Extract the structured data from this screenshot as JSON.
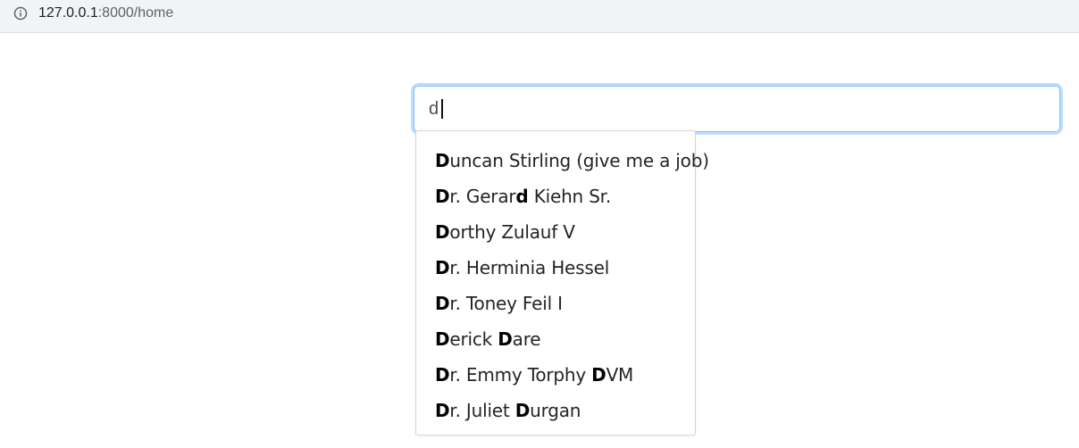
{
  "browser": {
    "url_host": "127.0.0.1",
    "url_path": ":8000/home",
    "info_icon": "info-circle-icon"
  },
  "search": {
    "value": "d"
  },
  "suggestions": [
    {
      "segments": [
        {
          "t": "D",
          "b": true
        },
        {
          "t": "uncan Stirling (give me a job)",
          "b": false
        }
      ]
    },
    {
      "segments": [
        {
          "t": "D",
          "b": true
        },
        {
          "t": "r. Gerar",
          "b": false
        },
        {
          "t": "d",
          "b": true
        },
        {
          "t": " Kiehn Sr.",
          "b": false
        }
      ]
    },
    {
      "segments": [
        {
          "t": "D",
          "b": true
        },
        {
          "t": "orthy Zulauf V",
          "b": false
        }
      ]
    },
    {
      "segments": [
        {
          "t": "D",
          "b": true
        },
        {
          "t": "r. Herminia Hessel",
          "b": false
        }
      ]
    },
    {
      "segments": [
        {
          "t": "D",
          "b": true
        },
        {
          "t": "r. Toney Feil I",
          "b": false
        }
      ]
    },
    {
      "segments": [
        {
          "t": "D",
          "b": true
        },
        {
          "t": "erick ",
          "b": false
        },
        {
          "t": "D",
          "b": true
        },
        {
          "t": "are",
          "b": false
        }
      ]
    },
    {
      "segments": [
        {
          "t": "D",
          "b": true
        },
        {
          "t": "r. Emmy Torphy ",
          "b": false
        },
        {
          "t": "D",
          "b": true
        },
        {
          "t": "VM",
          "b": false
        }
      ]
    },
    {
      "segments": [
        {
          "t": "D",
          "b": true
        },
        {
          "t": "r. Juliet ",
          "b": false
        },
        {
          "t": "D",
          "b": true
        },
        {
          "t": "urgan",
          "b": false
        }
      ]
    }
  ]
}
